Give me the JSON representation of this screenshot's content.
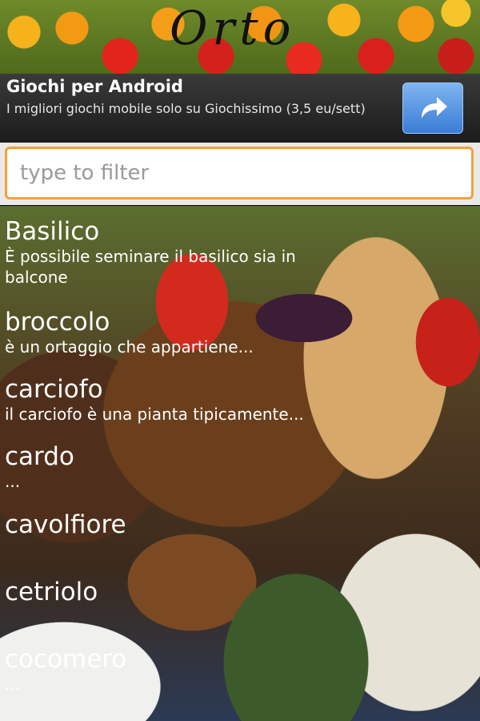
{
  "header": {
    "logo_text": "Orto"
  },
  "ad": {
    "title": "Giochi per Android",
    "text": "I migliori giochi mobile solo su Giochissimo (3,5 eu/sett)",
    "button_icon": "share-arrow-icon"
  },
  "search": {
    "placeholder": "type to filter",
    "value": ""
  },
  "items": [
    {
      "title": "Basilico",
      "subtitle": "È possibile seminare il basilico sia in balcone"
    },
    {
      "title": "broccolo",
      "subtitle": "è un ortaggio che appartiene..."
    },
    {
      "title": "carciofo",
      "subtitle": "il carciofo è una pianta tipicamente..."
    },
    {
      "title": "cardo",
      "subtitle": "..."
    },
    {
      "title": "cavolfiore",
      "subtitle": ""
    },
    {
      "title": "cetriolo",
      "subtitle": ""
    },
    {
      "title": "cocomero",
      "subtitle": "..."
    }
  ],
  "colors": {
    "accent": "#f7a037",
    "ad_button": "#3a7dd6"
  }
}
